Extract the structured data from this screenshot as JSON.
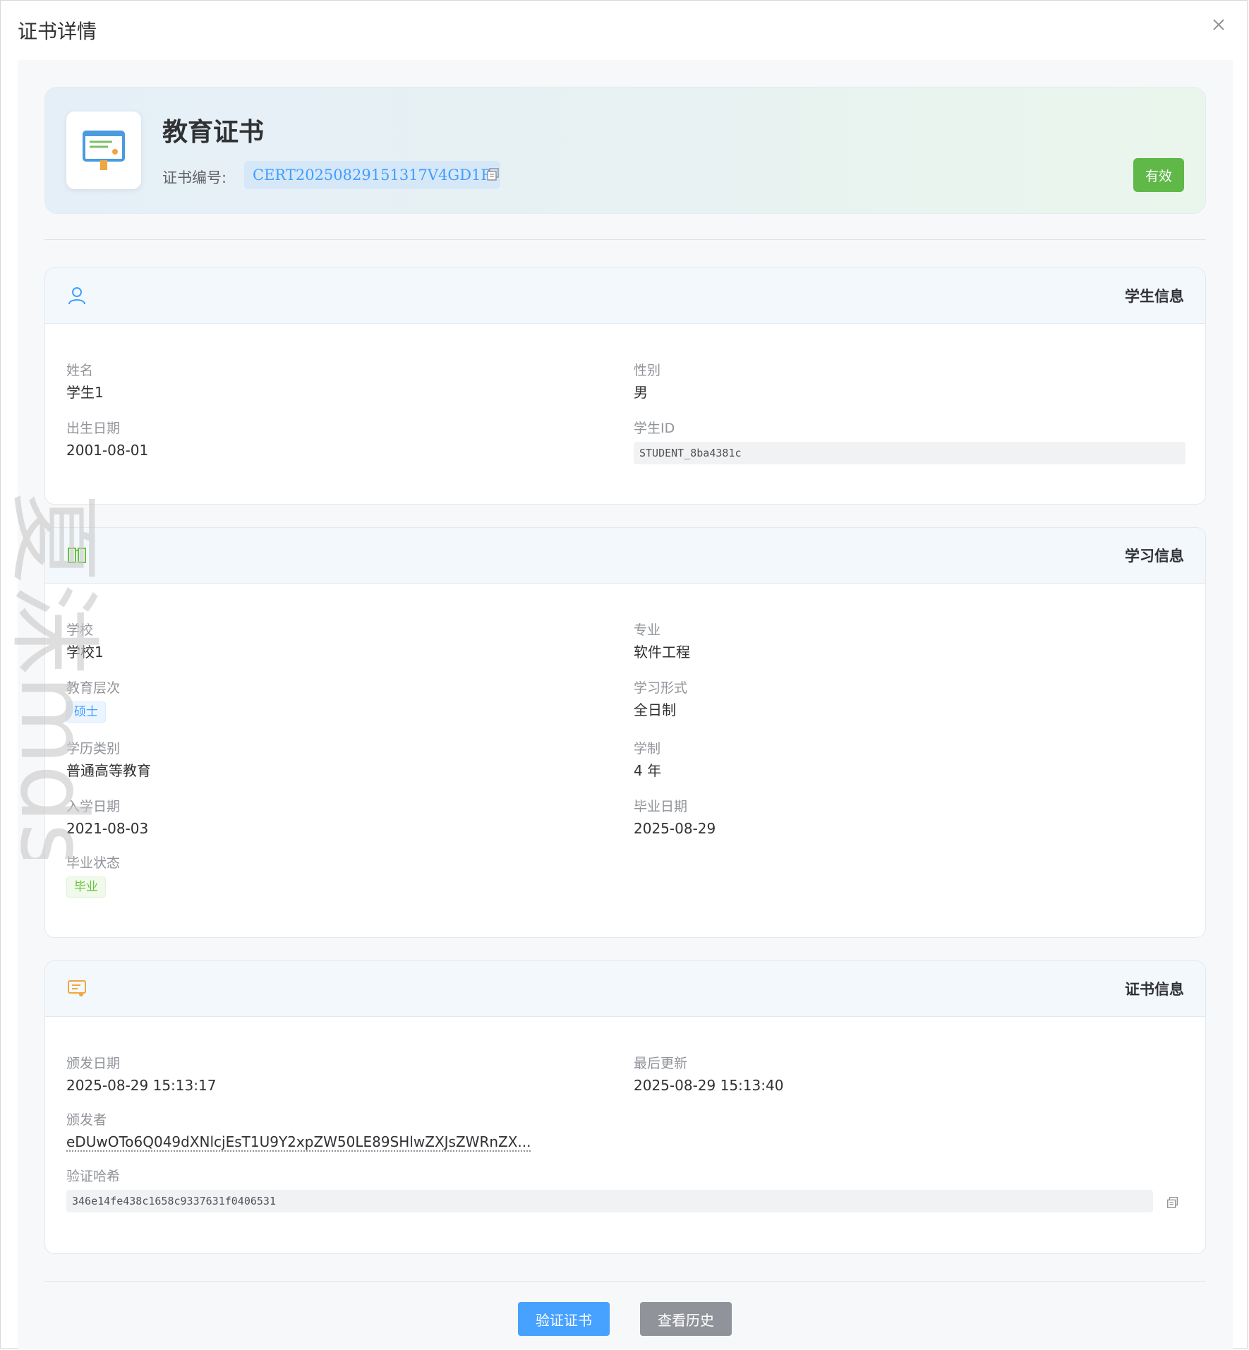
{
  "dialog": {
    "title": "证书详情"
  },
  "certificate": {
    "title": "教育证书",
    "number_label": "证书编号:",
    "number": "CERT20250829151317V4GD1R",
    "status": "有效"
  },
  "student_section": {
    "title": "学生信息",
    "name_label": "姓名",
    "name": "学生1",
    "gender_label": "性别",
    "gender": "男",
    "birth_label": "出生日期",
    "birth": "2001-08-01",
    "id_label": "学生ID",
    "id": "STUDENT_8ba4381c"
  },
  "study_section": {
    "title": "学习信息",
    "school_label": "学校",
    "school": "学校1",
    "major_label": "专业",
    "major": "软件工程",
    "level_label": "教育层次",
    "level": "硕士",
    "mode_label": "学习形式",
    "mode": "全日制",
    "category_label": "学历类别",
    "category": "普通高等教育",
    "duration_label": "学制",
    "duration": "4 年",
    "enroll_label": "入学日期",
    "enroll": "2021-08-03",
    "graduate_label": "毕业日期",
    "graduate": "2025-08-29",
    "grad_status_label": "毕业状态",
    "grad_status": "毕业"
  },
  "cert_section": {
    "title": "证书信息",
    "issue_label": "颁发日期",
    "issue": "2025-08-29 15:13:17",
    "updated_label": "最后更新",
    "updated": "2025-08-29 15:13:40",
    "issuer_label": "颁发者",
    "issuer": "eDUwOTo6Q049dXNlcjEsT1U9Y2xpZW50LE89SHlwZXJsZWRnZX...",
    "hash_label": "验证哈希",
    "hash": "346e14fe438c1658c9337631f0406531"
  },
  "actions": {
    "verify": "验证证书",
    "history": "查看历史"
  },
  "watermark": "夏沫mds",
  "colors": {
    "primary": "#409eff",
    "success": "#67c23a",
    "status_bg": "#5fb847",
    "secondary_btn": "#909399"
  }
}
